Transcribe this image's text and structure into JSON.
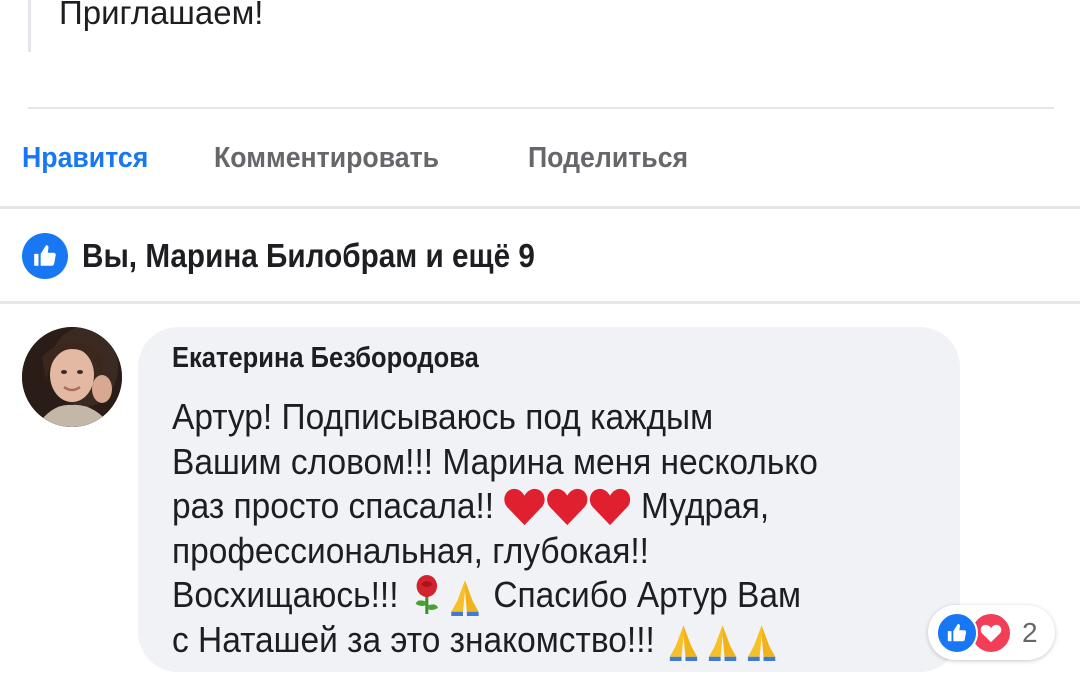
{
  "post": {
    "text": "Приглашаем!"
  },
  "actions": {
    "like_label": "Нравится",
    "comment_label": "Комментировать",
    "share_label": "Поделиться"
  },
  "likes_summary": {
    "text": "Вы, Марина Билобрам и ещё 9",
    "icon": "like-icon"
  },
  "comment": {
    "author": "Екатерина Безбородова",
    "lines": [
      "Артур! Подписываюсь под каждым",
      "Вашим словом!!! Марина меня несколько",
      "раз просто спасала!!",
      "Мудрая,",
      "профессиональная, глубокая!!",
      "Восхищаюсь!!!",
      "Спасибо Артур Вам",
      "с Наташей за это знакомство!!!"
    ],
    "emoji": [
      "heart",
      "heart",
      "heart",
      "rose",
      "folded-hands",
      "folded-hands",
      "folded-hands",
      "folded-hands"
    ],
    "reactions": {
      "icons": [
        "like-icon",
        "love-icon"
      ],
      "count": "2"
    }
  },
  "colors": {
    "accent": "#1877f2",
    "text": "#1c1e21",
    "secondary": "#65676b",
    "bubble": "#f0f2f5",
    "love": "#f33e58"
  }
}
